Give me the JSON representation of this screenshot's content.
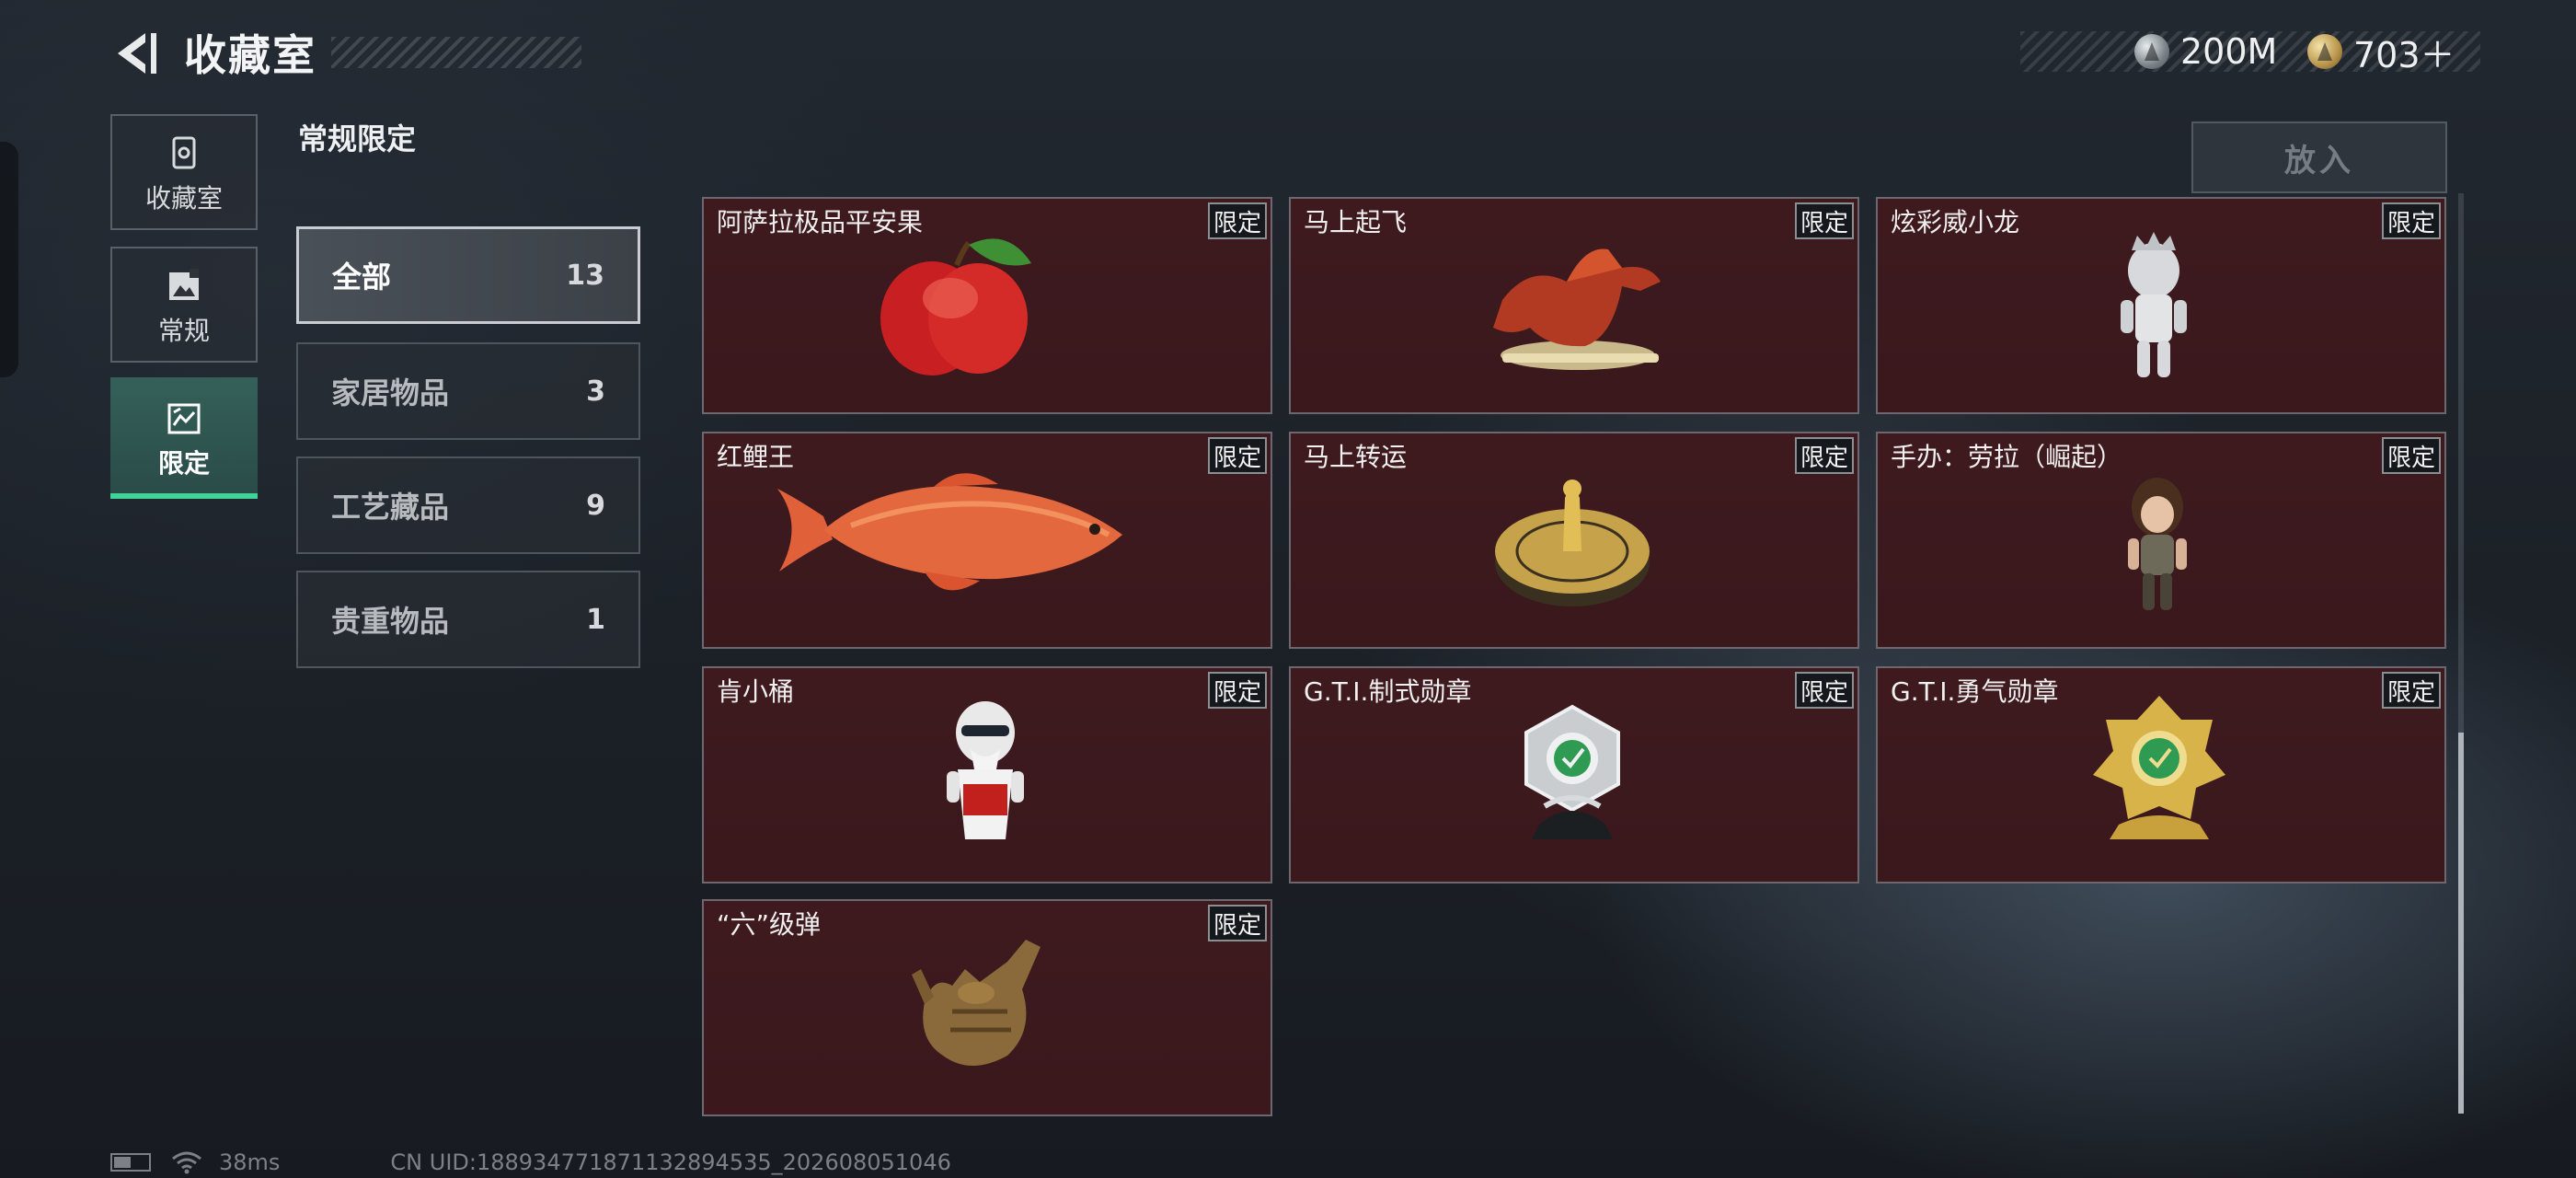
{
  "header": {
    "title": "收藏室",
    "currencies": [
      {
        "icon": "silver-coin-icon",
        "amount": "200M"
      },
      {
        "icon": "gold-coin-icon",
        "amount": "703＋"
      }
    ]
  },
  "nav": {
    "tabs": [
      {
        "label": "收藏室",
        "icon": "collection-icon"
      },
      {
        "label": "常规",
        "icon": "regular-icon"
      },
      {
        "label": "限定",
        "icon": "limited-icon",
        "active": true
      }
    ]
  },
  "section": {
    "title": "常规限定"
  },
  "categories": [
    {
      "label": "全部",
      "count": "13",
      "active": true
    },
    {
      "label": "家居物品",
      "count": "3"
    },
    {
      "label": "工艺藏品",
      "count": "9"
    },
    {
      "label": "贵重物品",
      "count": "1"
    }
  ],
  "put_in_label": "放入",
  "items": [
    {
      "name": "阿萨拉极品平安果",
      "tag": "限定",
      "art": "red-apple"
    },
    {
      "name": "马上起飞",
      "tag": "限定",
      "art": "horse-statue"
    },
    {
      "name": "炫彩威小龙",
      "tag": "限定",
      "art": "silver-figurine"
    },
    {
      "name": "红鲤王",
      "tag": "限定",
      "art": "red-carp"
    },
    {
      "name": "马上转运",
      "tag": "限定",
      "art": "spinning-top"
    },
    {
      "name": "手办：劳拉（崛起）",
      "tag": "限定",
      "art": "lara-figure"
    },
    {
      "name": "肯小桶",
      "tag": "限定",
      "art": "kfc-bucket-figure"
    },
    {
      "name": "G.T.I.制式勋章",
      "tag": "限定",
      "art": "silver-medal"
    },
    {
      "name": "G.T.I.勇气勋章",
      "tag": "限定",
      "art": "gold-medal"
    },
    {
      "name": "“六”级弹",
      "tag": "限定",
      "art": "bronze-hand"
    }
  ],
  "status": {
    "ping": "38ms",
    "uid": "CN UID:18893477187113289453​5_202608051046"
  },
  "colors": {
    "accent": "#3fd39a",
    "item_bg": "#3e1a1f"
  }
}
